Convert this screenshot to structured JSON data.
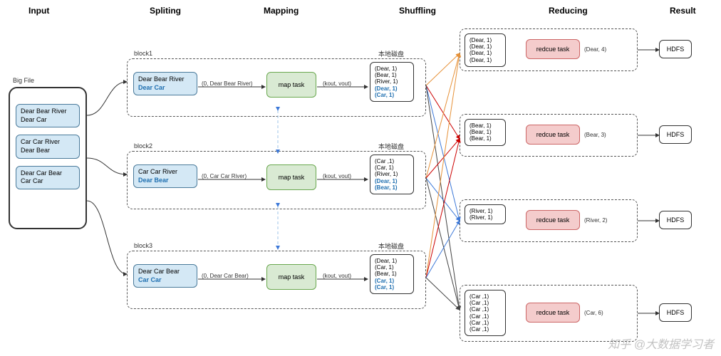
{
  "stages": {
    "input": "Input",
    "splitting": "Spliting",
    "mapping": "Mapping",
    "shuffling": "Shuffling",
    "reducing": "Reducing",
    "result": "Result"
  },
  "input": {
    "title": "Big File",
    "lines": [
      [
        "Dear Bear River",
        "Dear Car"
      ],
      [
        "Car Car River",
        "Dear Bear"
      ],
      [
        "Dear Car Bear",
        "Car Car"
      ]
    ]
  },
  "blocks": [
    {
      "name": "block1",
      "split": [
        "Dear Bear River",
        "Dear Car"
      ],
      "kv": "(0, Dear Bear River)",
      "map": "map task",
      "kout": "(kout, vout)",
      "disk": "本地磁盘",
      "out": [
        "(Dear, 1)",
        "(Bear, 1)",
        "(River, 1)",
        "(Dear, 1)",
        "(Car, 1)"
      ],
      "blue_from": 3
    },
    {
      "name": "block2",
      "split": [
        "Car Car River",
        "Dear Bear"
      ],
      "kv": "(0, Car Car River)",
      "map": "map task",
      "kout": "(kout, vout)",
      "disk": "本地磁盘",
      "out": [
        "(Car ,1)",
        "(Car, 1)",
        "(River, 1)",
        "(Dear, 1)",
        "(Bear, 1)"
      ],
      "blue_from": 3
    },
    {
      "name": "block3",
      "split": [
        "Dear Car Bear",
        "Car Car"
      ],
      "kv": "(0, Dear Car Bear)",
      "map": "map task",
      "kout": "(kout, vout)",
      "disk": "本地磁盘",
      "out": [
        "(Dear, 1)",
        "(Car, 1)",
        "(Bear, 1)",
        "(Car, 1)",
        "(Car, 1)"
      ],
      "blue_from": 3
    }
  ],
  "shuffle": [
    {
      "items": [
        "(Dear, 1)",
        "(Dear, 1)",
        "(Dear, 1)",
        "(Dear, 1)"
      ],
      "task": "redcue task",
      "result": "(Dear, 4)",
      "hdfs": "HDFS"
    },
    {
      "items": [
        "(Bear, 1)",
        "(Bear, 1)",
        "(Bear, 1)"
      ],
      "task": "redcue task",
      "result": "(Bear, 3)",
      "hdfs": "HDFS"
    },
    {
      "items": [
        "(River, 1)",
        "(River, 1)"
      ],
      "task": "redcue task",
      "result": "(River, 2)",
      "hdfs": "HDFS"
    },
    {
      "items": [
        "(Car ,1)",
        "(Car ,1)",
        "(Car ,1)",
        "(Car ,1)",
        "(Car ,1)",
        "(Car ,1)"
      ],
      "task": "redcue task",
      "result": "(Car, 6)",
      "hdfs": "HDFS"
    }
  ],
  "watermark": "知乎 @大数据学习者"
}
